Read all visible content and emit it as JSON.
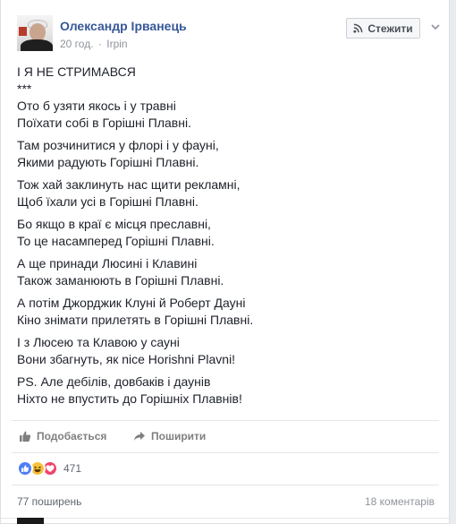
{
  "post": {
    "author": "Олександр Ірванець",
    "time": "20 год.",
    "separator": "·",
    "place": "Irpin",
    "follow_label": "Стежити",
    "paragraphs": [
      [
        "І Я НЕ СТРИМАВСЯ",
        "***",
        "Ото б узяти якось і у травні",
        "Поїхати собі в Горішні Плавні."
      ],
      [
        "Там розчинитися у флорі і у фауні,",
        "Якими радують Горішні Плавні."
      ],
      [
        "Тож хай заклинуть нас щити рекламні,",
        "Щоб їхали усі в Горішні Плавні."
      ],
      [
        "Бо якщо в краї є місця преславні,",
        "То це насамперед Горішні Плавні."
      ],
      [
        "А ще принади Люсині і Клавині",
        "Також заманюють в Горішні Плавні."
      ],
      [
        "А потім Джорджик Клуні й Роберт Дауні",
        "Кіно знімати прилетять в Горішні Плавні."
      ],
      [
        "І з Люсею та Клавою у сауні",
        "Вони збагнуть, як nice Horishni Plavni!"
      ],
      [
        "PS. Але дебілів, довбаків і даунів",
        "Ніхто не впустить до Горішніх Плавнів!"
      ]
    ]
  },
  "actions": {
    "like_label": "Подобається",
    "share_label": "Поширити"
  },
  "stats": {
    "reaction_icons": [
      "like-icon",
      "haha-icon",
      "love-icon"
    ],
    "reactions_count": "471",
    "shares": "77 поширень",
    "comments": "18 коментарів"
  },
  "colors": {
    "link": "#365899",
    "like_reaction": "#4f7ef7",
    "haha_reaction": "#f7c33d",
    "love_reaction": "#f2436a"
  }
}
